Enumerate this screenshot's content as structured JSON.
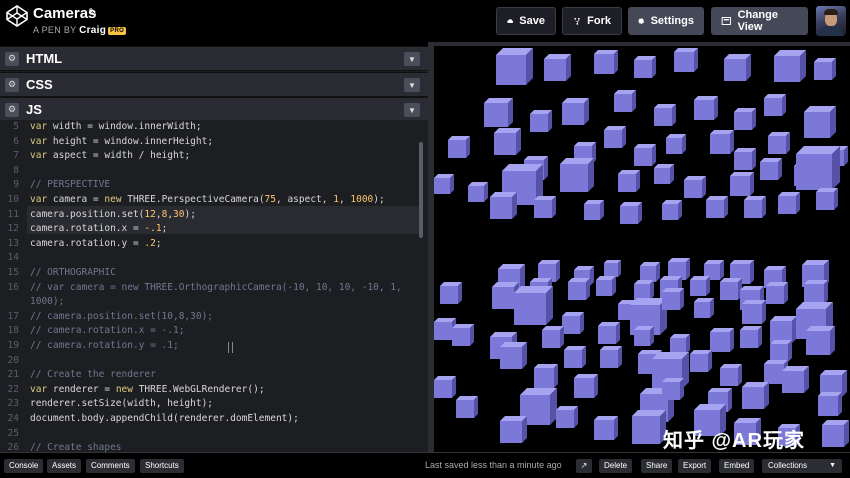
{
  "header": {
    "pen_title": "Cameras",
    "pen_by": "A PEN BY",
    "author": "Craig",
    "pro_badge": "PRO",
    "buttons": {
      "save": "Save",
      "fork": "Fork",
      "settings": "Settings",
      "change_view": "Change View"
    }
  },
  "panels": {
    "html": "HTML",
    "css": "CSS",
    "js": "JS"
  },
  "code_lines": [
    {
      "n": "5",
      "t": "var width = window.innerWidth;"
    },
    {
      "n": "6",
      "t": "var height = window.innerHeight;"
    },
    {
      "n": "7",
      "t": "var aspect = width / height;"
    },
    {
      "n": "8",
      "t": ""
    },
    {
      "n": "9",
      "t": "// PERSPECTIVE"
    },
    {
      "n": "10",
      "t": "var camera = new THREE.PerspectiveCamera(75, aspect, 1, 1000);"
    },
    {
      "n": "11",
      "t": "camera.position.set(12,8,30);"
    },
    {
      "n": "12",
      "t": "camera.rotation.x = -.1;"
    },
    {
      "n": "13",
      "t": "camera.rotation.y = .2;"
    },
    {
      "n": "14",
      "t": ""
    },
    {
      "n": "15",
      "t": "// ORTHOGRAPHIC"
    },
    {
      "n": "16",
      "t": "// var camera = new THREE.OrthographicCamera(-10, 10, 10, -10, 1,"
    },
    {
      "n": "",
      "t": "1000);"
    },
    {
      "n": "17",
      "t": "// camera.position.set(10,8,30);"
    },
    {
      "n": "18",
      "t": "// camera.rotation.x = -.1;"
    },
    {
      "n": "19",
      "t": "// camera.rotation.y = .1;"
    },
    {
      "n": "20",
      "t": ""
    },
    {
      "n": "21",
      "t": "// Create the renderer"
    },
    {
      "n": "22",
      "t": "var renderer = new THREE.WebGLRenderer();"
    },
    {
      "n": "23",
      "t": "renderer.setSize(width, height);"
    },
    {
      "n": "24",
      "t": "document.body.appendChild(renderer.domElement);"
    },
    {
      "n": "25",
      "t": ""
    },
    {
      "n": "26",
      "t": "// Create shapes"
    }
  ],
  "footer": {
    "console": "Console",
    "assets": "Assets",
    "comments": "Comments",
    "shortcuts": "Shortcuts",
    "saved_status": "Last saved less than a minute ago",
    "delete": "Delete",
    "share": "Share",
    "export": "Export",
    "embed": "Embed",
    "collections": "Collections"
  },
  "watermark": "知乎 @AR玩家",
  "colors": {
    "cube_face": "#7b78d8",
    "cube_top": "#a6a3f0",
    "cube_side": "#5552a8",
    "accent": "#f6c342"
  },
  "icons": [
    "codepen-logo-icon",
    "pencil-icon",
    "cloud-icon",
    "fork-icon",
    "gear-icon",
    "change-view-icon",
    "chevron-down-icon",
    "external-link-icon"
  ]
}
